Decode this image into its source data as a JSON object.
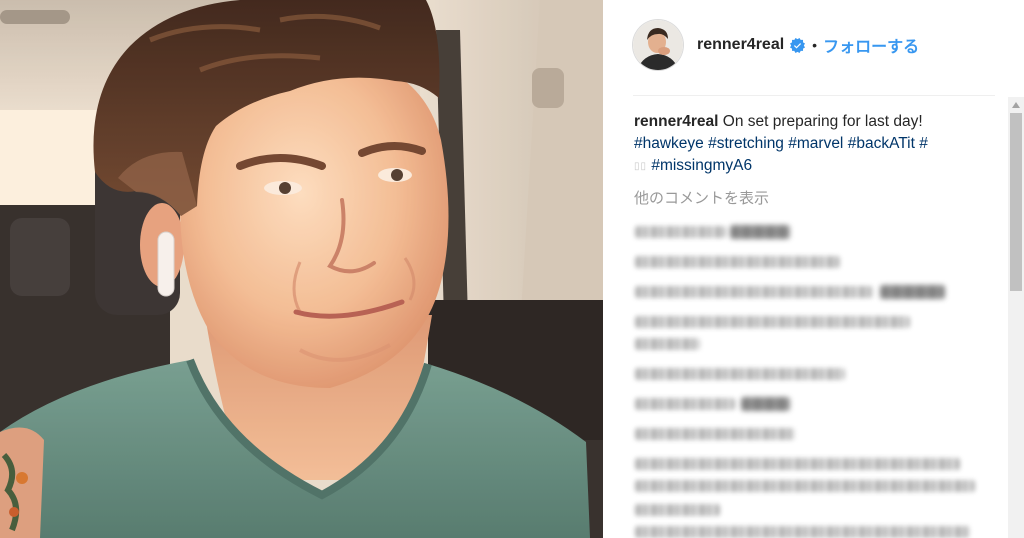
{
  "header": {
    "avatar_icon": "profile-avatar",
    "username": "renner4real",
    "verified_icon": "verified-badge-icon",
    "separator": "•",
    "follow_label": "フォローする"
  },
  "caption": {
    "username": "renner4real",
    "text": "On set preparing for last day!",
    "hashtags_line1": [
      "#hawkeye",
      "#stretching",
      "#marvel",
      "#backATit",
      "#"
    ],
    "hashtags_line2": [
      "▯▯",
      "#missingmyA6"
    ]
  },
  "comments": {
    "load_more_label": "他のコメントを表示"
  },
  "scrollbar": {
    "arrow_icon": "scroll-up-arrow-icon"
  },
  "colors": {
    "text": "#262626",
    "follow": "#3897f0",
    "verified": "#3897f0",
    "hashtag": "#003569",
    "muted": "#999999",
    "divider": "#efefef"
  }
}
